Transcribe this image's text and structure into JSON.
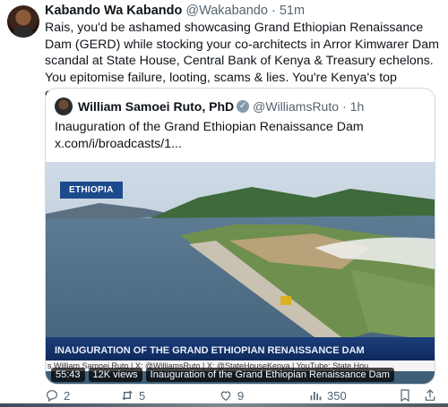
{
  "tweet": {
    "author_name": "Kabando Wa Kabando",
    "handle": "@Wakabando",
    "separator": "·",
    "time": "51m",
    "text": "Rais, you'd be ashamed showcasing Grand Ethiopian Renaissance Dam (GERD) while stocking your co-architects in Arror Kimwarer Dam scandal at State House, Central Bank of Kenya & Treasury echelons. You epitomise failure, looting, scams & lies. You're Kenya's top existential threat!"
  },
  "quoted": {
    "author_name": "William Samoei Ruto, PhD",
    "handle": "@WilliamsRuto",
    "separator": "·",
    "time": "1h",
    "verified_glyph": "✓",
    "line1": "Inauguration of the Grand Ethiopian Renaissance Dam",
    "line2": "x.com/i/broadcasts/1...",
    "media": {
      "tag": "ETHIOPIA",
      "banner": "INAUGURATION OF THE GRAND ETHIOPIAN RENAISSANCE DAM",
      "ticker": "s William Samoei Ruto | X: @WilliamsRuto | X: @StateHouseKenya | YouTube: State Hou",
      "duration": "55:43",
      "views": "12K views",
      "caption": "Inauguration of the Grand Ethiopian Renaissance Dam"
    }
  },
  "actions": {
    "replies": "2",
    "reposts": "5",
    "likes": "9",
    "views": "350"
  }
}
